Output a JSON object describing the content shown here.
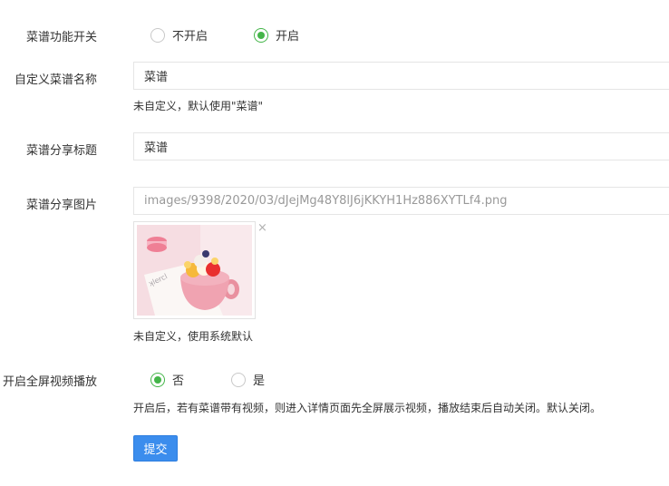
{
  "recipe_switch": {
    "label": "菜谱功能开关",
    "options": [
      {
        "label": "不开启",
        "checked": false
      },
      {
        "label": "开启",
        "checked": true
      }
    ]
  },
  "custom_name": {
    "label": "自定义菜谱名称",
    "value": "菜谱",
    "help": "未自定义，默认使用\"菜谱\""
  },
  "share_title": {
    "label": "菜谱分享标题",
    "value": "菜谱"
  },
  "share_image": {
    "label": "菜谱分享图片",
    "value": "images/9398/2020/03/dJejMg48Y8lJ6jKKYH1Hz886XYTLf4.png",
    "remove_icon": "×",
    "help": "未自定义，使用系统默认"
  },
  "fullscreen_video": {
    "label": "开启全屏视频播放",
    "options": [
      {
        "label": "否",
        "checked": true
      },
      {
        "label": "是",
        "checked": false
      }
    ],
    "help": "开启后，若有菜谱带有视频，则进入详情页面先全屏展示视频，播放结束后自动关闭。默认关闭。"
  },
  "submit_label": "提交",
  "colors": {
    "accent_green": "#44b549",
    "submit_blue": "#3b8ded"
  }
}
